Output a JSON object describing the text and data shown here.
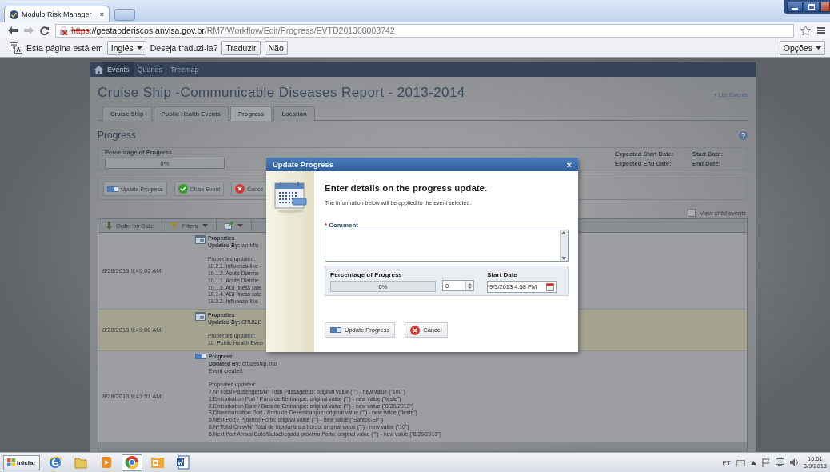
{
  "browser": {
    "tab_title": "Modulo Risk Manager",
    "tab_close": "×",
    "url_scheme": "https",
    "url_host": "://gestaoderiscos.anvisa.gov.br",
    "url_path": "/RM7/Workflow/Edit/Progress/EVTD201308003742"
  },
  "translate_bar": {
    "text": "Esta página está em",
    "language": "Inglês",
    "question": "Deseja traduzi-la?",
    "buttons": [
      "Traduzir",
      "Não"
    ],
    "options": "Opções"
  },
  "nav": [
    {
      "label": "Events",
      "selected": true
    },
    {
      "label": "Queries",
      "selected": false
    },
    {
      "label": "Treemap",
      "selected": false
    }
  ],
  "page": {
    "title": "Cruise Ship -Communicable Diseases Report - 2013-2014",
    "list_link": "List Events",
    "tabs": [
      {
        "label": "Cruise Ship",
        "selected": false
      },
      {
        "label": "Public Health Events",
        "selected": false
      },
      {
        "label": "Progress",
        "selected": true
      },
      {
        "label": "Location",
        "selected": false
      }
    ],
    "section_title": "Progress",
    "progress": {
      "label": "Percentage of Progress",
      "level": 0,
      "reading": "0%"
    },
    "dates": [
      "Expected Start Date:",
      "Start Date:",
      "Expected End Date:",
      "End Date:"
    ],
    "actions": [
      {
        "label": "Update Progress",
        "kind": "progress"
      },
      {
        "label": "Close Event",
        "kind": "check"
      },
      {
        "label": "Cance",
        "kind": "cancel"
      }
    ],
    "view_child_events": {
      "label": "View child events",
      "checked": false
    },
    "toolbar": {
      "order": "Order by Date",
      "filters": "Filters"
    },
    "events": [
      {
        "date": "8/28/2013 9:49:02 AM",
        "kind": "properties",
        "selected": false,
        "title": "Properties",
        "updated_by": "**Updated By:** workflo",
        "heading": "Properties updated:",
        "lines": [
          "10.2.1. Influenza-like -",
          "10.1.2. Acute Diarrhe",
          "10.1.1. Acute Diarrhe",
          "10.1.5. ADI Ilness rate",
          "10.1.4. ADI Ilness rate",
          "10.2.2. Influenza-like -"
        ]
      },
      {
        "date": "8/28/2013 9:49:00 AM",
        "kind": "properties",
        "selected": true,
        "title": "Properties",
        "updated_by": "**Updated By:** CRUIZE",
        "heading": "Properties updated:",
        "lines": [
          "10. Public Health Even"
        ]
      },
      {
        "date": "8/28/2013 9:41:51 AM",
        "kind": "progress",
        "selected": false,
        "title": "Progress",
        "updated_by": "**Updated By:** cruizeship.imo",
        "details": [
          "Event created."
        ],
        "heading": "Properties updated:",
        "lines": [
          "7.Nº Total Passengers/Nº Total Passageiros: original value (\"\") - new value (\"100\")",
          "1.Embarkation Port / Porto de Embarque: original value (\"\") - new value (\"teste\")",
          "2.Embarkation Date / Data de Embarque: original value (\"\") - new value (\"8/29/2013\")",
          "3.Disembarkation Port / Porto de Desembarque: original value (\"\") - new value (\"teste\")",
          "5.Next Port / Próximo Porto: original value (\"\") - new value (\"Santos-SP\")",
          "8.Nº Total Crew/Nº Total de tripulantes a bordo: original value (\"\") - new value (\"10\")",
          "6.Next Port Arrival Date/Datachegada próximo Porto: original value (\"\") - new value (\"8/29/2013\")"
        ]
      }
    ]
  },
  "dialog": {
    "title": "Update Progress",
    "close": "×",
    "heading": "Enter details on the progress update.",
    "subtitle": "The information below will be applied to the event selected.",
    "comment_required": "*",
    "comment_label": "Comment",
    "progress": {
      "label": "Percentage of Progress",
      "level": 0,
      "reading": "0%",
      "value": "0"
    },
    "start_date": {
      "label": "Start Date",
      "value": "9/3/2013 4:58 PM"
    },
    "buttons": [
      {
        "label": "Update Progress",
        "kind": "progress"
      },
      {
        "label": "Cancel",
        "kind": "cancel"
      }
    ]
  },
  "taskbar": {
    "start": "Iniciar",
    "language": "PT",
    "time": "16:51",
    "date": "3/9/2013"
  }
}
